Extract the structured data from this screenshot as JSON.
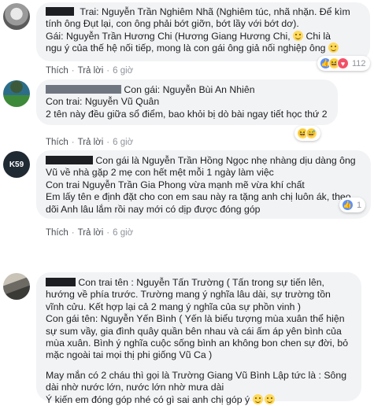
{
  "comments": [
    {
      "author_suffix": "Trai",
      "lines": [
        "Trai: Nguyễn Trần Nghiêm Nhã (Nghiêm túc, nhã nhặn. Để kìm",
        "tính ông Đụt lại, con ông phải bớt giỡn, bớt lầy với bớt dơ).",
        "Gái: Nguyễn Trần Hương Chi (Hương Giang Hương Chi,",
        "Chi là",
        "ngu ý của thế hệ nối tiếp, mong là con gái ông giả nối nghiệp ông"
      ],
      "actions": {
        "like": "Thích",
        "reply": "Trả lời",
        "time": "6 giờ"
      },
      "reactions": {
        "icons": [
          "like-icon",
          "haha-icon",
          "love-icon"
        ],
        "count": "112"
      }
    },
    {
      "author_name": "Con gái: Nguyễn Bùi An Nhiên",
      "lines": [
        "Con trai: Nguyễn Vũ Quân",
        "2 tên này đều giữa sổ điểm, bao khỏi bị dò bài ngay tiết học thứ 2"
      ],
      "actions": {
        "like": "Thích",
        "reply": "Trả lời",
        "time": "6 giờ"
      },
      "reactions": {
        "icons": [
          "haha-icon",
          "sweat-icon"
        ],
        "count": ""
      }
    },
    {
      "author_name": "Con gái là Nguyễn Trần Hồng Ngọc nhẹ nhàng dịu dàng ông",
      "lines": [
        "Vũ về nhà gặp 2 mẹ con hết mệt mỗi 1 ngày làm việc",
        "Con trai Nguyễn Trần Gia Phong vừa mạnh mẽ vừa khí chất",
        "Em lấy tên e định đặt cho con em sau này ra tặng anh chị luôn ák, theo",
        "dõi Anh lâu lắm rồi nay mới có dịp được đóng góp"
      ],
      "actions": {
        "like": "Thích",
        "reply": "Trả lời",
        "time": "6 giờ"
      },
      "reactions": {
        "icons": [
          "like-icon"
        ],
        "count": "1"
      },
      "avatar_text": "K59"
    },
    {
      "author_name": "Con trai tên : Nguyễn Tấn Trường ( Tấn trong sự tiến lên,",
      "lines": [
        "hướng về phía trước. Trường mang ý nghĩa lâu dài, sự trường tồn",
        "vĩnh cửu. Kết hợp lại cả 2 mang ý nghĩa của sự phồn vinh )",
        "Con gái tên: Nguyễn Yến Bình ( Yến là biểu tượng mùa xuân thể hiện",
        "sự sum vầy, gia đình quây quần bên nhau và cái ấm áp yên bình của",
        "mùa xuân. Bình ý nghĩa cuộc sống bình an không bon chen sự đời, bỏ",
        "mặc ngoài tai mọi thị phi giống Vũ Ca )",
        "",
        "May mắn có 2 cháu thì gọi là Trường Giang Vũ Bình Lập tức là : Sông",
        "dài nhờ nước lớn, nước lớn nhờ mưa dài",
        "Ý kiến em đóng góp nhé có gì sai anh chị góp ý"
      ],
      "actions": {
        "like": "Thích",
        "reply": "Trả lời",
        "time": "6 giờ"
      }
    }
  ],
  "colors": {
    "link": "#385898",
    "bubble": "#f2f3f5",
    "meta": "#90949c"
  }
}
